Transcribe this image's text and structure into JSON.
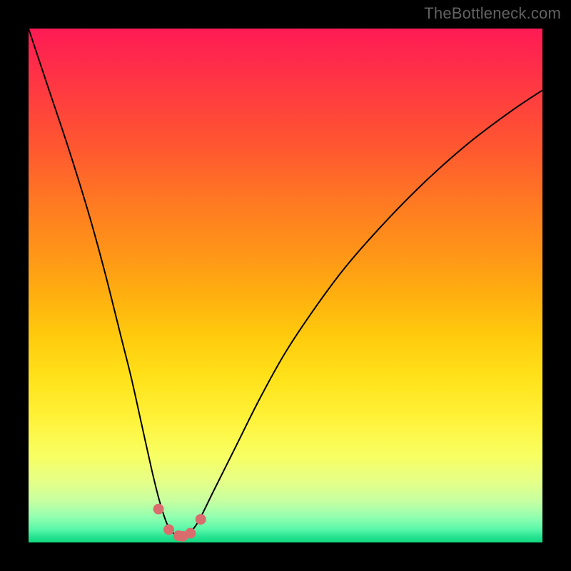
{
  "watermark": "TheBottleneck.com",
  "colors": {
    "frame": "#000000",
    "watermark_text": "#626262",
    "curve": "#000000",
    "dot": "#d96d6e",
    "gradient_top": "#ff1b54",
    "gradient_bottom": "#13d97f"
  },
  "chart_data": {
    "type": "line",
    "title": "",
    "xlabel": "",
    "ylabel": "",
    "xlim": [
      0,
      100
    ],
    "ylim": [
      0,
      100
    ],
    "grid": false,
    "legend": false,
    "annotations": [
      "TheBottleneck.com"
    ],
    "series": [
      {
        "name": "bottleneck-curve",
        "x": [
          0,
          4,
          8,
          12,
          15,
          18,
          20,
          22,
          24,
          25.5,
          27,
          28.5,
          30,
          31,
          33,
          36,
          40,
          45,
          50,
          56,
          62,
          70,
          78,
          86,
          94,
          100
        ],
        "values": [
          100,
          88,
          76,
          63,
          52,
          40,
          32,
          23,
          14,
          8,
          3.5,
          1.5,
          1,
          1.5,
          4,
          10,
          18,
          28,
          37,
          46,
          54,
          63,
          71,
          78,
          84,
          88
        ]
      }
    ],
    "dots": [
      {
        "x": 25.3,
        "y": 6.5
      },
      {
        "x": 27.3,
        "y": 2.5
      },
      {
        "x": 29.2,
        "y": 1.3
      },
      {
        "x": 30.0,
        "y": 1.2
      },
      {
        "x": 31.5,
        "y": 1.8
      },
      {
        "x": 33.5,
        "y": 4.5
      }
    ],
    "notch_x": 30,
    "background_gradient": "bottleneck-rainbow"
  }
}
